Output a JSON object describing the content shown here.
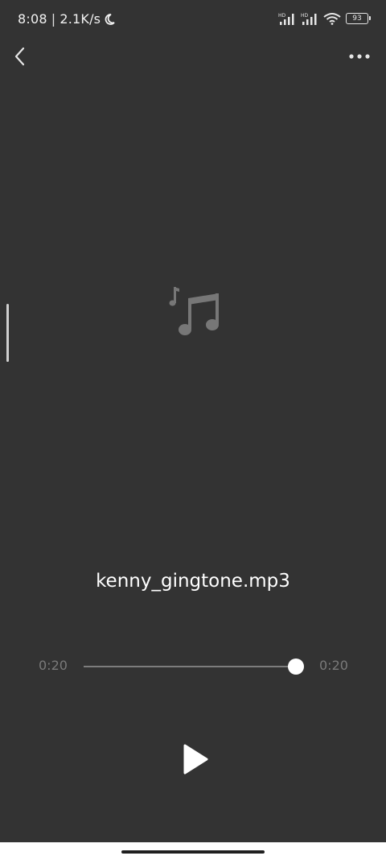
{
  "status_bar": {
    "time": "8:08",
    "separator": "|",
    "net_speed": "2.1K/s",
    "battery_level": "93",
    "icons": [
      "moon-icon",
      "signal-hd-icon",
      "signal-hd-icon",
      "wifi-icon",
      "battery-icon"
    ]
  },
  "toolbar": {
    "back_icon": "chevron-left-icon",
    "more_icon": "more-horizontal-icon"
  },
  "player": {
    "artwork_icon": "music-notes-icon",
    "file_name": "kenny_gingtone.mp3",
    "current_time": "0:20",
    "total_time": "0:20",
    "progress": 1.0,
    "play_icon": "play-icon"
  },
  "colors": {
    "background": "#333333",
    "text": "#ffffff",
    "muted_text": "#7a7a7a",
    "track": "#7d7d7d",
    "artwork": "#777777"
  }
}
